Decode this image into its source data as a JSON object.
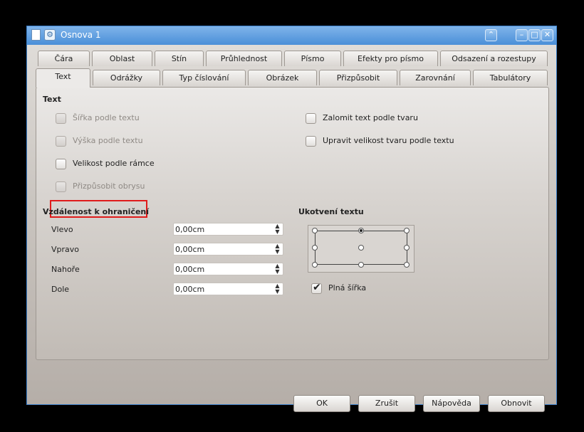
{
  "window": {
    "title": "Osnova 1"
  },
  "tabs_row1": [
    "Čára",
    "Oblast",
    "Stín",
    "Průhlednost",
    "Písmo",
    "Efekty pro písmo",
    "Odsazení a rozestupy"
  ],
  "tabs_row2": [
    "Text",
    "Odrážky",
    "Typ číslování",
    "Obrázek",
    "Přizpůsobit",
    "Zarovnání",
    "Tabulátory"
  ],
  "text_section": {
    "header": "Text",
    "options": {
      "fit_width": "Šířka podle textu",
      "fit_height": "Výška podle textu",
      "fit_frame": "Velikost podle rámce",
      "fit_contour": "Přizpůsobit obrysu",
      "word_wrap": "Zalomit text podle tvaru",
      "resize_shape": "Upravit velikost tvaru podle textu"
    }
  },
  "spacing_section": {
    "header": "Vzdálenost k ohraničení",
    "left_label": "Vlevo",
    "left_value": "0,00cm",
    "right_label": "Vpravo",
    "right_value": "0,00cm",
    "top_label": "Nahoře",
    "top_value": "0,00cm",
    "bottom_label": "Dole",
    "bottom_value": "0,00cm"
  },
  "anchor_section": {
    "header": "Ukotvení textu",
    "full_width_label": "Plná šířka",
    "full_width_checked": true
  },
  "buttons": {
    "ok": "OK",
    "cancel": "Zrušit",
    "help": "Nápověda",
    "reset": "Obnovit"
  },
  "icons": {
    "document": "document-icon",
    "app": "app-icon",
    "keep_above": "chevron-up-icon",
    "minimize": "minimize-icon",
    "maximize": "maximize-icon",
    "close": "close-icon"
  },
  "colors": {
    "titlebar": "#4a8fd8",
    "highlight": "#e01b1b"
  }
}
